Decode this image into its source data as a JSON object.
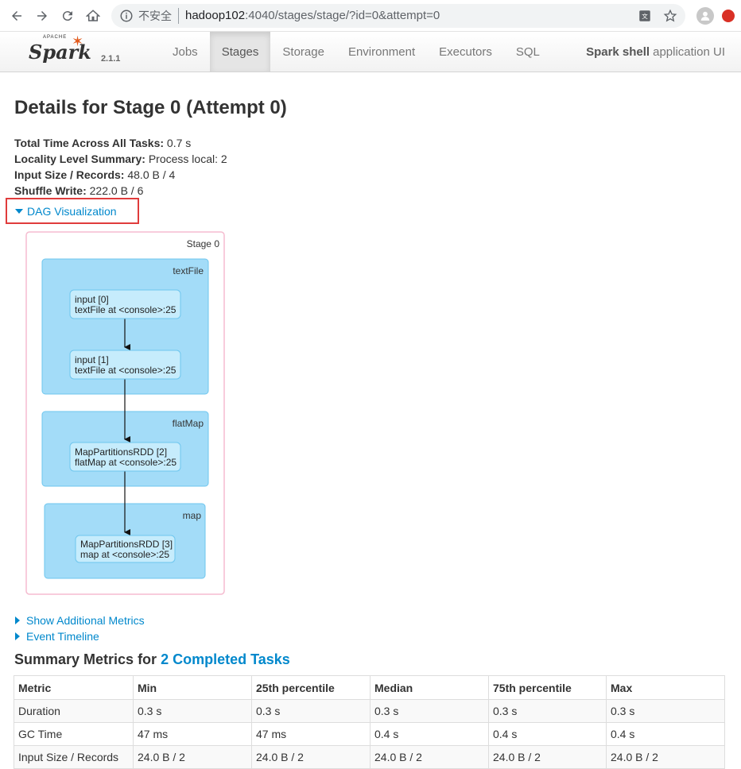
{
  "browser": {
    "insecure_label": "不安全",
    "url_host": "hadoop102",
    "url_path": ":4040/stages/stage/?id=0&attempt=0"
  },
  "navbar": {
    "brand_apache": "APACHE",
    "brand_name": "Spark",
    "version": "2.1.1",
    "tabs": [
      {
        "label": "Jobs",
        "active": false
      },
      {
        "label": "Stages",
        "active": true
      },
      {
        "label": "Storage",
        "active": false
      },
      {
        "label": "Environment",
        "active": false
      },
      {
        "label": "Executors",
        "active": false
      },
      {
        "label": "SQL",
        "active": false
      }
    ],
    "app_name": "Spark shell",
    "app_suffix": "application UI"
  },
  "page": {
    "title": "Details for Stage 0 (Attempt 0)",
    "summary": [
      {
        "label": "Total Time Across All Tasks:",
        "value": "0.7 s"
      },
      {
        "label": "Locality Level Summary:",
        "value": "Process local: 2"
      },
      {
        "label": "Input Size / Records:",
        "value": "48.0 B / 4"
      },
      {
        "label": "Shuffle Write:",
        "value": "222.0 B / 6"
      }
    ],
    "dag_toggle": "DAG Visualization",
    "show_metrics": "Show Additional Metrics",
    "event_timeline": "Event Timeline"
  },
  "dag": {
    "stage_label": "Stage 0",
    "clusters": [
      {
        "label": "textFile",
        "nodes": [
          {
            "line1": "input [0]",
            "line2": "textFile at <console>:25"
          },
          {
            "line1": "input [1]",
            "line2": "textFile at <console>:25"
          }
        ]
      },
      {
        "label": "flatMap",
        "nodes": [
          {
            "line1": "MapPartitionsRDD [2]",
            "line2": "flatMap at <console>:25"
          }
        ]
      },
      {
        "label": "map",
        "nodes": [
          {
            "line1": "MapPartitionsRDD [3]",
            "line2": "map at <console>:25"
          }
        ]
      }
    ]
  },
  "metrics": {
    "heading_prefix": "Summary Metrics for",
    "heading_link": "2 Completed Tasks",
    "columns": [
      "Metric",
      "Min",
      "25th percentile",
      "Median",
      "75th percentile",
      "Max"
    ],
    "rows": [
      [
        "Duration",
        "0.3 s",
        "0.3 s",
        "0.3 s",
        "0.3 s",
        "0.3 s"
      ],
      [
        "GC Time",
        "47 ms",
        "47 ms",
        "0.4 s",
        "0.4 s",
        "0.4 s"
      ],
      [
        "Input Size / Records",
        "24.0 B / 2",
        "24.0 B / 2",
        "24.0 B / 2",
        "24.0 B / 2",
        "24.0 B / 2"
      ]
    ]
  }
}
